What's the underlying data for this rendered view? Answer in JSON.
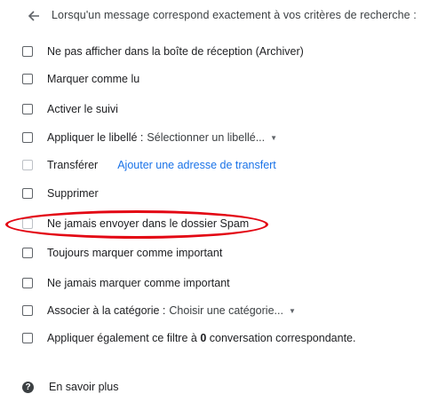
{
  "header": {
    "back_icon": "arrow-left-icon",
    "text": "Lorsqu'un message correspond exactement à vos critères de recherche :"
  },
  "options": {
    "archive": "Ne pas afficher dans la boîte de réception (Archiver)",
    "mark_read": "Marquer comme lu",
    "star": "Activer le suivi",
    "apply_label": "Appliquer le libellé :",
    "apply_label_dropdown": "Sélectionner un libellé...",
    "forward": "Transférer",
    "forward_link": "Ajouter une adresse de transfert",
    "delete": "Supprimer",
    "never_spam": "Ne jamais envoyer dans le dossier Spam",
    "always_important": "Toujours marquer comme important",
    "never_important": "Ne jamais marquer comme important",
    "category": "Associer à la catégorie :",
    "category_dropdown": "Choisir une catégorie...",
    "also_apply_prefix": "Appliquer également ce filtre à",
    "also_apply_count": "0",
    "also_apply_suffix": "conversation correspondante."
  },
  "footer": {
    "help_icon": "question-circle-icon",
    "help_text": "En savoir plus"
  },
  "colors": {
    "highlight_oval": "#e30613",
    "link": "#1a73e8"
  }
}
